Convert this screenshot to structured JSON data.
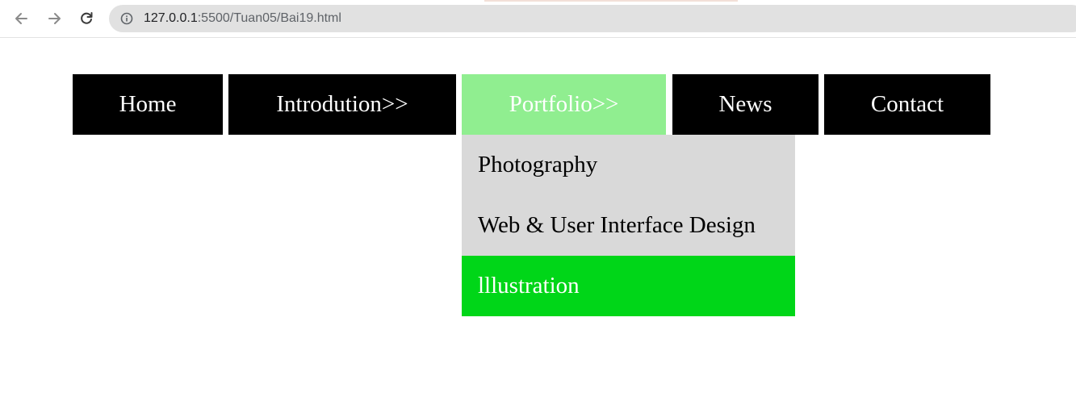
{
  "browser": {
    "back_icon": "arrow-left-icon",
    "forward_icon": "arrow-right-icon",
    "reload_icon": "reload-icon",
    "info_icon": "info-icon",
    "url_host": "127.0.0.1",
    "url_rest": ":5500/Tuan05/Bai19.html"
  },
  "menu": {
    "items": [
      {
        "label": "Home"
      },
      {
        "label": "Introdution>>"
      },
      {
        "label": "Portfolio>>",
        "active": true
      },
      {
        "label": "News"
      },
      {
        "label": "Contact"
      }
    ],
    "dropdown": [
      {
        "label": "Photography"
      },
      {
        "label": "Web & User Interface Design"
      },
      {
        "label": "lllustration",
        "hovered": true
      }
    ]
  },
  "colors": {
    "menu_bg": "#000000",
    "menu_text": "#ffffff",
    "active_bg": "#90ee90",
    "dropdown_bg": "#d9d9d9",
    "dropdown_hover_bg": "#00d618"
  }
}
